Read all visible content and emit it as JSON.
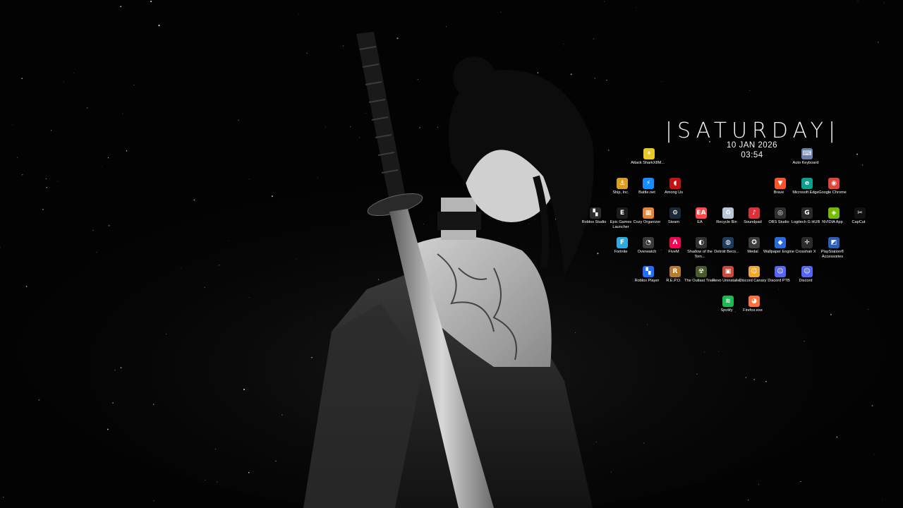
{
  "clock": {
    "day": "|SATURDAY|",
    "date": "10 JAN 2026",
    "time": "03:54"
  },
  "desktop_icons": [
    {
      "label": "Attack SharkX8M...",
      "icon": "attack-shark-icon",
      "color": "#e8c82a",
      "glyph": "✦"
    },
    {
      "label": "Auto Keyboard",
      "icon": "keyboard-icon",
      "color": "#6b7fa8",
      "glyph": "⌨"
    },
    {
      "label": "Ship, Inc.",
      "icon": "ship-inc-icon",
      "color": "#d8a020",
      "glyph": "⚓"
    },
    {
      "label": "Battle.net",
      "icon": "battlenet-icon",
      "color": "#148eff",
      "glyph": "⚡"
    },
    {
      "label": "Among Us",
      "icon": "among-us-icon",
      "color": "#c51111",
      "glyph": "◖"
    },
    {
      "label": "Brave",
      "icon": "brave-icon",
      "color": "#fb542b",
      "glyph": "▼"
    },
    {
      "label": "Microsoft Edge",
      "icon": "edge-icon",
      "color": "#0c9f8e",
      "glyph": "e"
    },
    {
      "label": "Google Chrome",
      "icon": "chrome-icon",
      "color": "#e0453a",
      "glyph": "◉"
    },
    {
      "label": "Roblox Studio",
      "icon": "roblox-studio-icon",
      "color": "#2c2c2c",
      "glyph": "▚"
    },
    {
      "label": "Epic Games Launcher",
      "icon": "epic-games-icon",
      "color": "#1b1b1b",
      "glyph": "E"
    },
    {
      "label": "Cozy Organizer",
      "icon": "cozy-organizer-icon",
      "color": "#e8833a",
      "glyph": "▦"
    },
    {
      "label": "Steam",
      "icon": "steam-icon",
      "color": "#1b2838",
      "glyph": "⚙"
    },
    {
      "label": "EA",
      "icon": "ea-icon",
      "color": "#ff4747",
      "glyph": "EA"
    },
    {
      "label": "Recycle Bin",
      "icon": "recycle-bin-icon",
      "color": "#b9c7d6",
      "glyph": "♻"
    },
    {
      "label": "Soundpad",
      "icon": "soundpad-icon",
      "color": "#d9303a",
      "glyph": "♪"
    },
    {
      "label": "OBS Studio",
      "icon": "obs-icon",
      "color": "#302e31",
      "glyph": "◎"
    },
    {
      "label": "Logitech G HUB",
      "icon": "logitech-icon",
      "color": "#2a2a2a",
      "glyph": "G"
    },
    {
      "label": "NVIDIA App",
      "icon": "nvidia-icon",
      "color": "#76b900",
      "glyph": "◈"
    },
    {
      "label": "CapCut",
      "icon": "capcut-icon",
      "color": "#111111",
      "glyph": "✂"
    },
    {
      "label": "Fortnite",
      "icon": "fortnite-icon",
      "color": "#2fa9e0",
      "glyph": "F"
    },
    {
      "label": "Overwatch",
      "icon": "overwatch-icon",
      "color": "#3a3a3a",
      "glyph": "◔"
    },
    {
      "label": "FiveM",
      "icon": "fivem-icon",
      "color": "#f40552",
      "glyph": "Λ"
    },
    {
      "label": "Shadow of the Tom...",
      "icon": "shadow-tomb-raider-icon",
      "color": "#333333",
      "glyph": "◐"
    },
    {
      "label": "Detroit Beco...",
      "icon": "detroit-icon",
      "color": "#1f3b5c",
      "glyph": "◍"
    },
    {
      "label": "Medal",
      "icon": "medal-icon",
      "color": "#3c3c3c",
      "glyph": "✪"
    },
    {
      "label": "Wallpaper Engine",
      "icon": "wallpaper-engine-icon",
      "color": "#2a6ad8",
      "glyph": "◆"
    },
    {
      "label": "Crosshair X",
      "icon": "crosshair-icon",
      "color": "#2b2b2b",
      "glyph": "✛"
    },
    {
      "label": "PlayStation® Accessories",
      "icon": "playstation-icon",
      "color": "#2b5fb5",
      "glyph": "◩"
    },
    {
      "label": "Roblox Player",
      "icon": "roblox-player-icon",
      "color": "#1f6fff",
      "glyph": "▚"
    },
    {
      "label": "R.E.P.O.",
      "icon": "repo-icon",
      "color": "#b97b2a",
      "glyph": "R"
    },
    {
      "label": "The Outlast Trials",
      "icon": "outlast-trials-icon",
      "color": "#4a5a2a",
      "glyph": "☢"
    },
    {
      "label": "Revo Uninstaller",
      "icon": "revo-uninstaller-icon",
      "color": "#c94a3a",
      "glyph": "▣"
    },
    {
      "label": "Discord Canary",
      "icon": "discord-canary-icon",
      "color": "#f4a52b",
      "glyph": "☺"
    },
    {
      "label": "Discord PTB",
      "icon": "discord-ptb-icon",
      "color": "#5865f2",
      "glyph": "☺"
    },
    {
      "label": "Discord",
      "icon": "discord-icon",
      "color": "#5865f2",
      "glyph": "☺"
    },
    {
      "label": "Spotify",
      "icon": "spotify-icon",
      "color": "#1db954",
      "glyph": "≋"
    },
    {
      "label": "Firefox.exe",
      "icon": "firefox-icon",
      "color": "#ff7139",
      "glyph": "◕"
    }
  ]
}
